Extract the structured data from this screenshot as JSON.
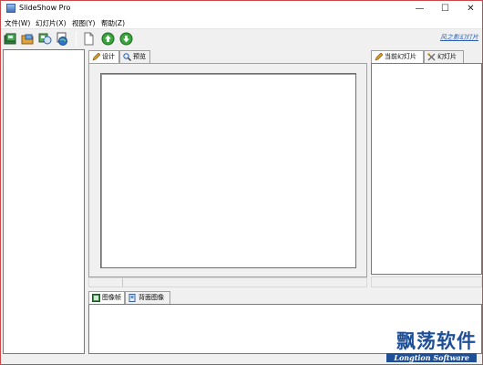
{
  "window": {
    "title": "SlideShow Pro",
    "minimize_label": "—",
    "maximize_label": "☐",
    "close_label": "✕"
  },
  "menu": [
    {
      "label": "文件(W)"
    },
    {
      "label": "幻灯片(X)"
    },
    {
      "label": "视图(Y)"
    },
    {
      "label": "帮助(Z)"
    }
  ],
  "toolbar": {
    "buttons": [
      "new-project-icon",
      "open-folder-icon",
      "image-browse-icon",
      "globe-icon",
      "blank-page-icon",
      "move-up-icon",
      "move-down-icon"
    ],
    "brand_link": "风之影幻灯片"
  },
  "design_tabs": [
    {
      "label": "设计",
      "icon": "design-pencil-icon"
    },
    {
      "label": "预览",
      "icon": "preview-magnifier-icon"
    }
  ],
  "right_tabs": [
    {
      "label": "当前幻灯片",
      "icon": "current-slide-icon"
    },
    {
      "label": "幻灯片",
      "icon": "slides-tools-icon"
    }
  ],
  "bottom_tabs": [
    {
      "label": "图像帧",
      "icon": "image-frame-icon"
    },
    {
      "label": "背面图像",
      "icon": "background-image-icon"
    }
  ],
  "watermark": {
    "cn": "飘荡软件",
    "en": "Longtion Software"
  },
  "colors": {
    "brand_blue": "#1f4f96",
    "window_border": "#c94a4a",
    "panel_bg": "#f0f0f0"
  }
}
